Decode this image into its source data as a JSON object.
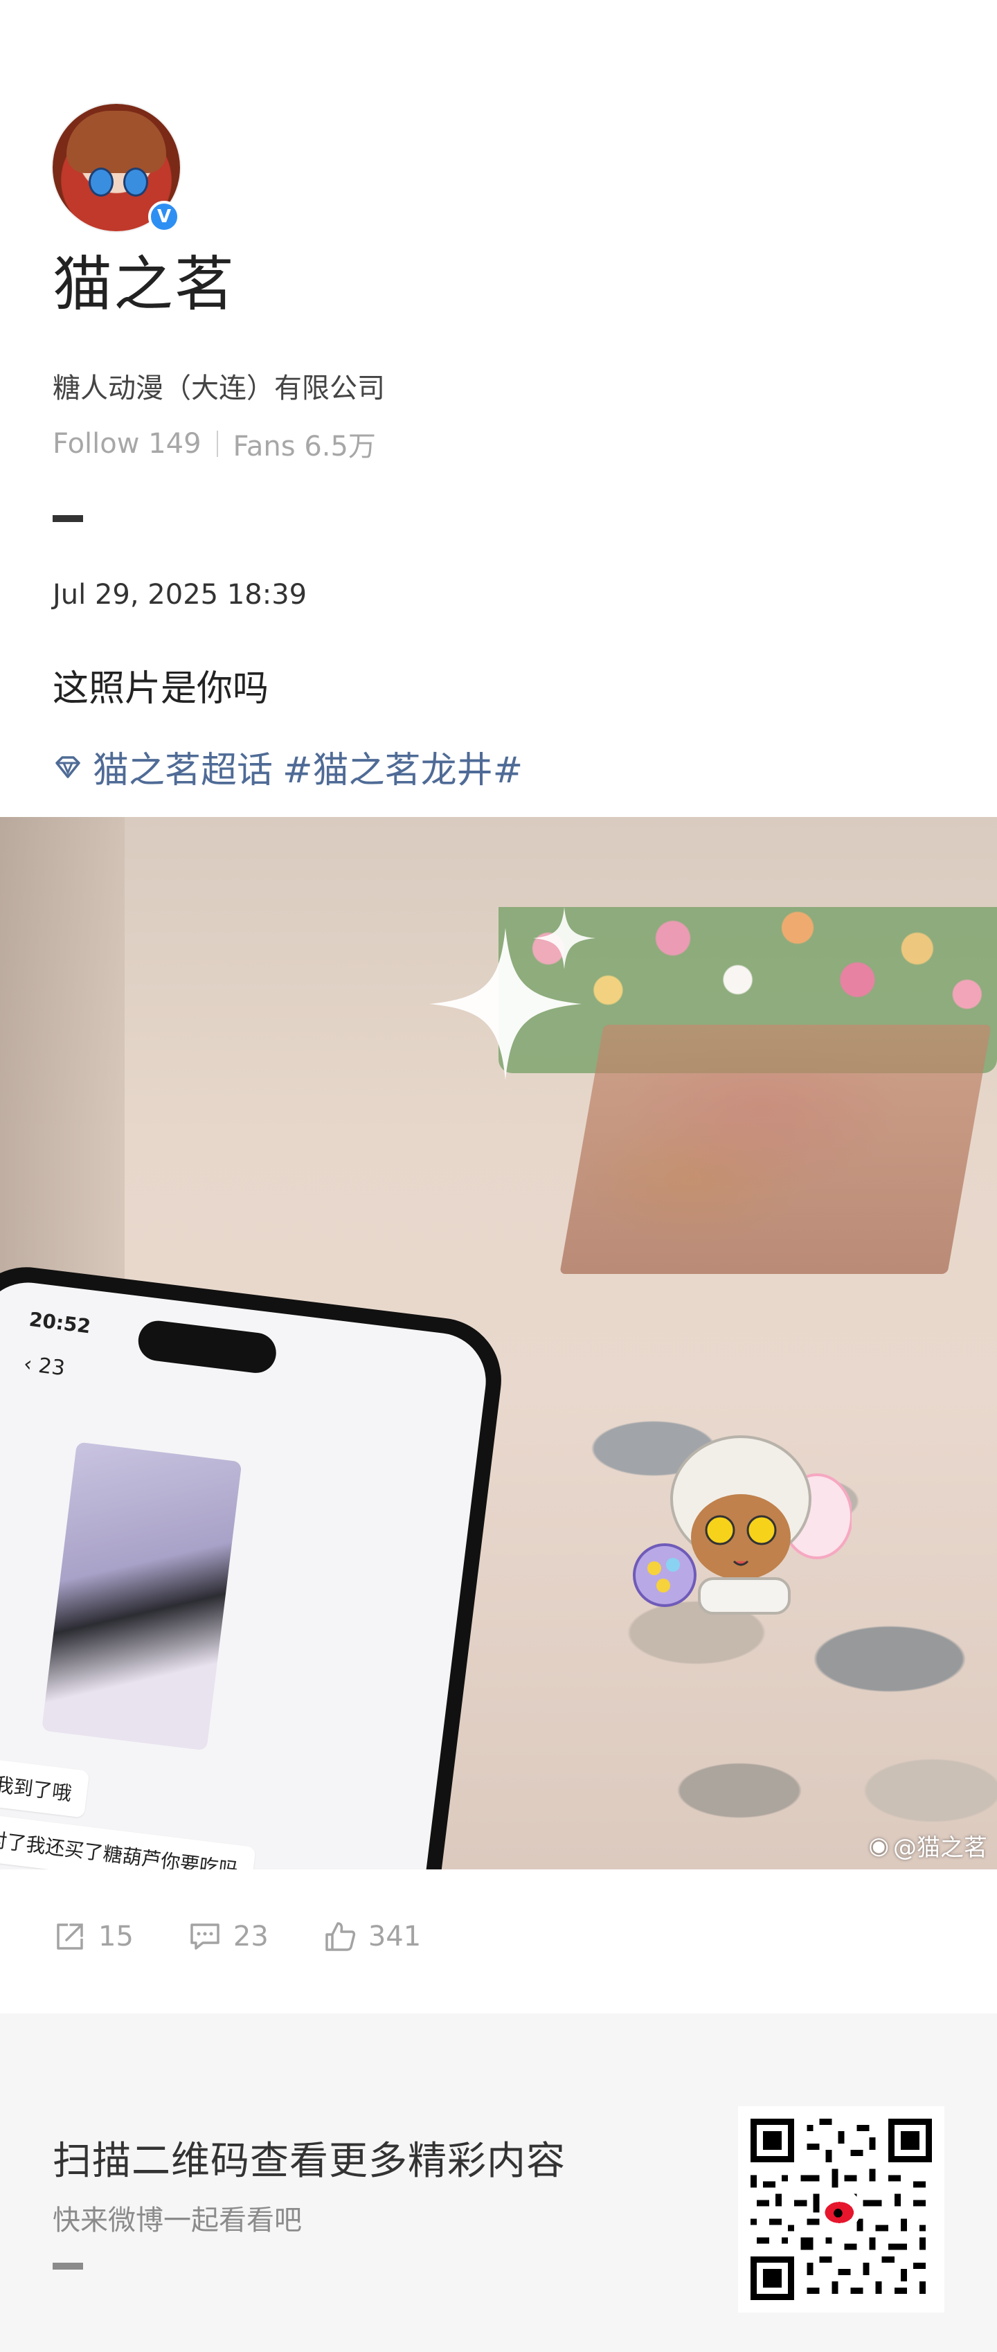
{
  "profile": {
    "name": "猫之茗",
    "company": "糖人动漫（大连）有限公司",
    "follow_label": "Follow",
    "follow_count": "149",
    "fans_label": "Fans",
    "fans_count": "6.5万",
    "verified": "V"
  },
  "post": {
    "date": "Jul 29, 2025 18:39",
    "text": "这照片是你吗",
    "supertopic": "猫之茗超话",
    "hashtag": "#猫之茗龙井#"
  },
  "photo": {
    "watermark": "@猫之茗",
    "phone_time": "20:52",
    "phone_back_count": "23",
    "chat_bubble_1": "我到了哦",
    "chat_bubble_2": "对了我还买了糖葫芦你要吃吗"
  },
  "actions": {
    "repost_count": "15",
    "comment_count": "23",
    "like_count": "341"
  },
  "footer": {
    "title": "扫描二维码查看更多精彩内容",
    "subtitle": "快来微博一起看看吧"
  },
  "colors": {
    "link": "#4f6b96",
    "muted": "#a3a3a3",
    "badge": "#2e8ff3"
  }
}
